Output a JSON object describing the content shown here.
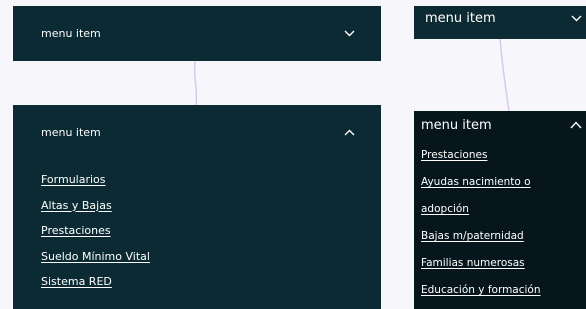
{
  "left": {
    "collapsed": {
      "title": "menu item",
      "chevron": "chevron-down-icon"
    },
    "expanded": {
      "title": "menu item",
      "chevron": "chevron-up-icon",
      "links": [
        "Formularios",
        "Altas y Bajas",
        "Prestaciones",
        "Sueldo Mínimo Vital",
        "Sistema RED"
      ]
    }
  },
  "right": {
    "collapsed": {
      "title": "menu item",
      "chevron": "chevron-down-icon"
    },
    "expanded": {
      "title": "menu item",
      "chevron": "chevron-up-icon",
      "links": [
        "Prestaciones",
        "Ayudas nacimiento o",
        "adopción",
        "Bajas m/paternidad",
        "Familias numerosas",
        "Educación y formación"
      ]
    }
  },
  "colors": {
    "panel": "#0b2a33",
    "panel_dark": "#06161c",
    "text": "#ffffff",
    "background": "#f7f7fb",
    "connector": "#d8c8ea"
  }
}
